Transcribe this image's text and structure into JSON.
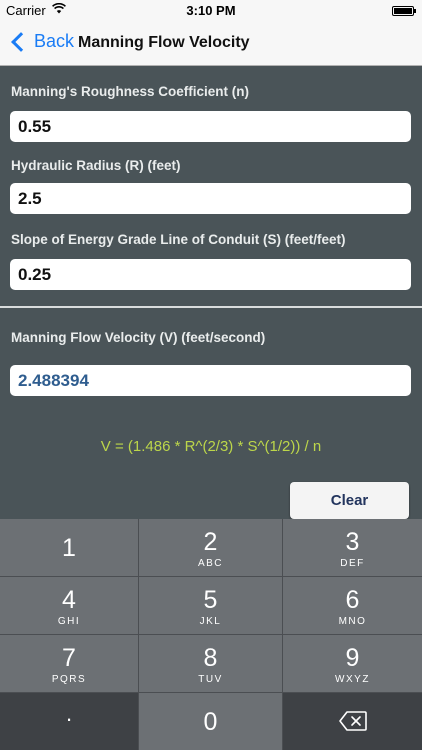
{
  "status_bar": {
    "carrier": "Carrier",
    "time": "3:10 PM"
  },
  "nav": {
    "back_label": "Back",
    "title": "Manning Flow Velocity"
  },
  "form": {
    "roughness_label": "Manning's Roughness Coefficient (n)",
    "roughness_value": "0.55",
    "radius_label": "Hydraulic Radius (R) (feet)",
    "radius_value": "2.5",
    "slope_label": "Slope of Energy Grade Line of Conduit (S) (feet/feet)",
    "slope_value": "0.25",
    "velocity_label": "Manning Flow Velocity (V) (feet/second)",
    "velocity_value": "2.488394",
    "formula": "V = (1.486 * R^(2/3) * S^(1/2)) / n",
    "clear_label": "Clear"
  },
  "keypad": {
    "keys": [
      {
        "number": "1",
        "letters": ""
      },
      {
        "number": "2",
        "letters": "ABC"
      },
      {
        "number": "3",
        "letters": "DEF"
      },
      {
        "number": "4",
        "letters": "GHI"
      },
      {
        "number": "5",
        "letters": "JKL"
      },
      {
        "number": "6",
        "letters": "MNO"
      },
      {
        "number": "7",
        "letters": "PQRS"
      },
      {
        "number": "8",
        "letters": "TUV"
      },
      {
        "number": "9",
        "letters": "WXYZ"
      },
      {
        "number": "0",
        "letters": ""
      }
    ],
    "decimal": ".",
    "delete_icon": "backspace-icon"
  },
  "colors": {
    "nav_tint": "#1a7cf5",
    "form_background": "#4a5458",
    "formula_text": "#bcd64a",
    "result_text": "#2f5d8f"
  }
}
